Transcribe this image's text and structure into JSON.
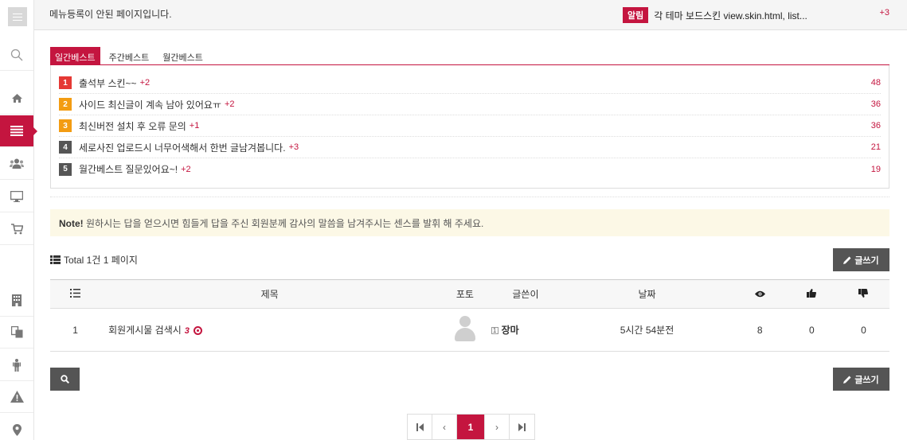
{
  "topbar": {
    "message": "메뉴등록이 안된 페이지입니다.",
    "notice_tag": "알림",
    "notice_text": "각 테마 보드스킨 view.skin.html, list...",
    "notice_count": "+3"
  },
  "sidebar": {
    "items": [
      {
        "icon": "search-icon"
      },
      {
        "icon": "home-icon"
      },
      {
        "icon": "list-icon",
        "active": true
      },
      {
        "icon": "users-icon"
      },
      {
        "icon": "desktop-icon"
      },
      {
        "icon": "cart-icon"
      },
      {
        "icon": "building-icon"
      },
      {
        "icon": "copy-icon"
      },
      {
        "icon": "person-icon"
      },
      {
        "icon": "warning-icon"
      },
      {
        "icon": "map-marker-icon"
      }
    ]
  },
  "best": {
    "tabs": [
      "일간베스트",
      "주간베스트",
      "월간베스트"
    ],
    "items": [
      {
        "rank": "1",
        "title": "출석부 스킨~~",
        "comments": "+2",
        "hits": "48"
      },
      {
        "rank": "2",
        "title": "사이드 최신글이 계속 남아 있어요ㅠ",
        "comments": "+2",
        "hits": "36"
      },
      {
        "rank": "3",
        "title": "최신버전 설치 후 오류 문의",
        "comments": "+1",
        "hits": "36"
      },
      {
        "rank": "4",
        "title": "세로사진 업로드시 너무어색해서 한번 글남겨봅니다.",
        "comments": "+3",
        "hits": "21"
      },
      {
        "rank": "5",
        "title": "월간베스트 질문있어요~!",
        "comments": "+2",
        "hits": "19"
      }
    ]
  },
  "note": {
    "label": "Note!",
    "text": "원하시는 답을 얻으시면 힘들게 답을 주신 회원분께 감사의 말씀을 남겨주시는 센스를 발휘 해 주세요."
  },
  "board": {
    "total": "Total 1건 1 페이지",
    "write_label": "글쓰기",
    "headers": {
      "subject": "제목",
      "photo": "포토",
      "writer": "글쓴이",
      "date": "날짜"
    },
    "rows": [
      {
        "num": "1",
        "subject": "회원게시물 검색시",
        "comment_count": "3",
        "writer_level": "1",
        "writer": "장마",
        "date": "5시간 54분전",
        "views": "8",
        "likes": "0",
        "dislikes": "0"
      }
    ]
  },
  "pagination": {
    "first": "⏮",
    "prev": "‹",
    "current": "1",
    "next": "›",
    "last": "⏭"
  },
  "colors": {
    "accent": "#c4153f",
    "note_bg": "#fcf8e6",
    "dark_button": "#555555"
  }
}
